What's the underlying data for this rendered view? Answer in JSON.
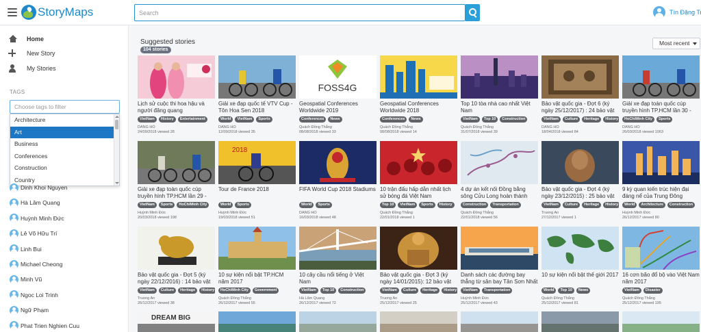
{
  "app": {
    "name": "StoryMaps"
  },
  "header": {
    "search_placeholder": "Search",
    "user_name": "Tín Đặng Trung"
  },
  "nav": [
    {
      "label": "Home",
      "icon": "home-icon"
    },
    {
      "label": "New Story",
      "icon": "plus-icon"
    },
    {
      "label": "My Stories",
      "icon": "user-icon"
    }
  ],
  "tags_panel": {
    "label": "TAGS",
    "placeholder": "Choose tags to filter",
    "options": [
      "Architecture",
      "Art",
      "Business",
      "Conferences",
      "Construction",
      "Country"
    ],
    "selected": "Art"
  },
  "users": [
    "Dinh Khoi Nguyen",
    "Hà Lâm Quang",
    "Huỳnh Minh Đức",
    "Lê Võ Hữu Trí",
    "Linh Bui",
    "Michael Cheong",
    "Minh Vũ",
    "Ngoc Loi Trinh",
    "Ngữ Phạm",
    "Phat Trien Nghien Cuu"
  ],
  "main": {
    "title": "Suggested stories",
    "count": "104 stories",
    "sort": "Most recent"
  },
  "stories": [
    {
      "title": "Lịch sử cuộc thi hoa hậu và người đăng quang",
      "tags": [
        "VietNam",
        "History",
        "Entertainment"
      ],
      "author": "DANG HO",
      "date": "24/09/2018",
      "views": "viewed 28"
    },
    {
      "title": "Giải xe đạp quốc tế VTV Cup - Tôn Hoa Sen 2018",
      "tags": [
        "World",
        "VietNam",
        "Sports"
      ],
      "author": "DANG HO",
      "date": "12/09/2018",
      "views": "viewed 35"
    },
    {
      "title": "Geospatial Conferences Worldwide 2019",
      "tags": [
        "Conferences",
        "News"
      ],
      "author": "Quách Đồng Thắng",
      "date": "08/08/2018",
      "views": "viewed 33"
    },
    {
      "title": "Geospatial Conferences Worldwide 2018",
      "tags": [
        "Conferences",
        "News"
      ],
      "author": "Quách Đồng Thắng",
      "date": "08/08/2018",
      "views": "viewed 14"
    },
    {
      "title": "Top 10 tòa nhà cao nhất Việt Nam",
      "tags": [
        "VietNam",
        "Top 10",
        "Construction"
      ],
      "author": "Quách Đồng Thắng",
      "date": "31/07/2018",
      "views": "viewed 39"
    },
    {
      "title": "Bảo vật quốc gia - Đợt 6 (ký ngày 25/12/2017) : 24 bảo vật",
      "tags": [
        "VietNam",
        "Culture",
        "Heritage",
        "History"
      ],
      "author": "DANG HO",
      "date": "18/04/2018",
      "views": "viewed 84"
    },
    {
      "title": "Giải xe đạp toàn quốc cúp truyền hình TP.HCM lần 30 - 2018",
      "tags": [
        "HoChiMinh City",
        "Sports"
      ],
      "author": "DANG HO",
      "date": "26/03/2018",
      "views": "viewed 1063"
    },
    {
      "title": "Giải xe đạp toàn quốc cúp truyền hình TP.HCM lần 29 - 2017",
      "tags": [
        "VietNam",
        "Sports",
        "HoChiMinh City"
      ],
      "author": "Huỳnh Minh Đức",
      "date": "20/03/2018",
      "views": "viewed 198"
    },
    {
      "title": "Tour de France 2018",
      "tags": [
        "World",
        "Sports"
      ],
      "author": "Huỳnh Minh Đức",
      "date": "19/03/2018",
      "views": "viewed 51"
    },
    {
      "title": "FIFA World Cup 2018 Stadiums",
      "tags": [
        "World",
        "Sports"
      ],
      "author": "DANG HO",
      "date": "16/03/2018",
      "views": "viewed 48"
    },
    {
      "title": "10 trận đấu hấp dẫn nhất lịch sử bóng đá Việt Nam",
      "tags": [
        "Top 10",
        "VietNam",
        "Sports",
        "History"
      ],
      "author": "Quách Đồng Thắng",
      "date": "22/01/2018",
      "views": "viewed 1"
    },
    {
      "title": "4 dự án kết nối Đồng bằng sông Cửu Long hoàn thành trong 2018",
      "tags": [
        "Construction",
        "Transportation"
      ],
      "author": "Quách Đồng Thắng",
      "date": "22/01/2018",
      "views": "viewed 56"
    },
    {
      "title": "Bảo vật quốc gia - Đợt 4 (ký ngày 23/12/2015) : 25 bảo vật",
      "tags": [
        "VietNam",
        "Culture",
        "Heritage",
        "History"
      ],
      "author": "Truong An",
      "date": "27/12/2017",
      "views": "viewed 1"
    },
    {
      "title": "9 kỳ quan kiến trúc hiện đại đáng nể của Trung Đông",
      "tags": [
        "World",
        "Architecture",
        "Construction"
      ],
      "author": "Huỳnh Minh Đức",
      "date": "26/12/2017",
      "views": "viewed 80"
    },
    {
      "title": "Bảo vật quốc gia - Đợt 5 (ký ngày 22/12/2016) : 14 bảo vật",
      "tags": [
        "VietNam",
        "Culture",
        "Heritage",
        "History"
      ],
      "author": "Truong An",
      "date": "26/12/2017",
      "views": "viewed 38"
    },
    {
      "title": "10 sự kiện nổi bật TP.HCM năm 2017",
      "tags": [
        "HoChiMinh City",
        "Government"
      ],
      "author": "Quách Đồng Thắng",
      "date": "26/12/2017",
      "views": "viewed 55"
    },
    {
      "title": "10 cây cầu nổi tiếng ở Việt Nam",
      "tags": [
        "VietNam",
        "Top 10",
        "Construction"
      ],
      "author": "Hà Lâm Quang",
      "date": "26/12/2017",
      "views": "viewed 72"
    },
    {
      "title": "Bảo vật quốc gia - Đợt 3 (ký ngày 14/01/2015): 12 bảo vật",
      "tags": [
        "VietNam",
        "Culture",
        "Heritage",
        "History"
      ],
      "author": "Truong An",
      "date": "25/12/2017",
      "views": "viewed 25"
    },
    {
      "title": "Danh sách các đường bay thẳng từ sân bay Tân Sơn Nhất",
      "tags": [
        "VietNam",
        "Transportation"
      ],
      "author": "Huỳnh Minh Đức",
      "date": "25/12/2017",
      "views": "viewed 43"
    },
    {
      "title": "10 sự kiện nổi bật thế giới 2017",
      "tags": [
        "World",
        "Top 10",
        "News"
      ],
      "author": "Quách Đồng Thắng",
      "date": "25/12/2017",
      "views": "viewed 81"
    },
    {
      "title": "16 cơn bão đổ bộ vào Việt Nam năm 2017",
      "tags": [
        "VietNam",
        "Disaster"
      ],
      "author": "Quách Đồng Thắng",
      "date": "25/12/2017",
      "views": "viewed 195"
    }
  ],
  "thumbs": [
    {
      "kind": "pageant",
      "bg": "#f6cbd8",
      "fg": "#e2457d"
    },
    {
      "kind": "cycle",
      "bg": "#7fb0d6",
      "fg": "#e5c530"
    },
    {
      "kind": "foss",
      "bg": "#ffffff",
      "fg": "#333333"
    },
    {
      "kind": "skyline",
      "bg": "#f7d84a",
      "fg": "#1f6fb4"
    },
    {
      "kind": "city",
      "bg": "#b98fc4",
      "fg": "#3a2d6a"
    },
    {
      "kind": "relief",
      "bg": "#8a6b45",
      "fg": "#5b432a"
    },
    {
      "kind": "cycle",
      "bg": "#6aa9d8",
      "fg": "#c53c30"
    },
    {
      "kind": "cycle",
      "bg": "#6f7a5a",
      "fg": "#d8d6c9"
    },
    {
      "kind": "tour",
      "bg": "#f0c12a",
      "fg": "#2f3d8f"
    },
    {
      "kind": "worldcup",
      "bg": "#1c2a66",
      "fg": "#d9a431"
    },
    {
      "kind": "crowd",
      "bg": "#c9252c",
      "fg": "#f5d36a"
    },
    {
      "kind": "map",
      "bg": "#dfe9ef",
      "fg": "#9c5a8f"
    },
    {
      "kind": "statue",
      "bg": "#3a4a5c",
      "fg": "#9a6b43"
    },
    {
      "kind": "towers",
      "bg": "#3a56a8",
      "fg": "#f2b458"
    },
    {
      "kind": "lion",
      "bg": "#f2f2ec",
      "fg": "#c99a2a"
    },
    {
      "kind": "hall",
      "bg": "#8fc0e8",
      "fg": "#d6b066"
    },
    {
      "kind": "bridge",
      "bg": "#c9a278",
      "fg": "#4a5e3e"
    },
    {
      "kind": "buddha",
      "bg": "#3b2416",
      "fg": "#c8913c"
    },
    {
      "kind": "airport",
      "bg": "#f6a54c",
      "fg": "#2d4966"
    },
    {
      "kind": "worldmap",
      "bg": "#cfe3f2",
      "fg": "#3d7f3f"
    },
    {
      "kind": "storm",
      "bg": "#7fb7e3",
      "fg": "#d24030"
    }
  ],
  "bottom_thumbs": [
    {
      "label": "DREAM BIG",
      "bg": "#f5f5f5",
      "fg": "#333333"
    },
    {
      "label": "",
      "bg": "#6fa7d9",
      "fg": "#2f6a3a"
    },
    {
      "label": "",
      "bg": "#bcd3e6",
      "fg": "#7d8a6a"
    },
    {
      "label": "",
      "bg": "#d4cfc5",
      "fg": "#8e7a5d"
    },
    {
      "label": "",
      "bg": "#cfe0ef",
      "fg": "#6f6253"
    },
    {
      "label": "",
      "bg": "#8a9aa8",
      "fg": "#4c5a4a"
    },
    {
      "label": "",
      "bg": "#d9e8f2",
      "fg": "#4e8a3e"
    }
  ]
}
